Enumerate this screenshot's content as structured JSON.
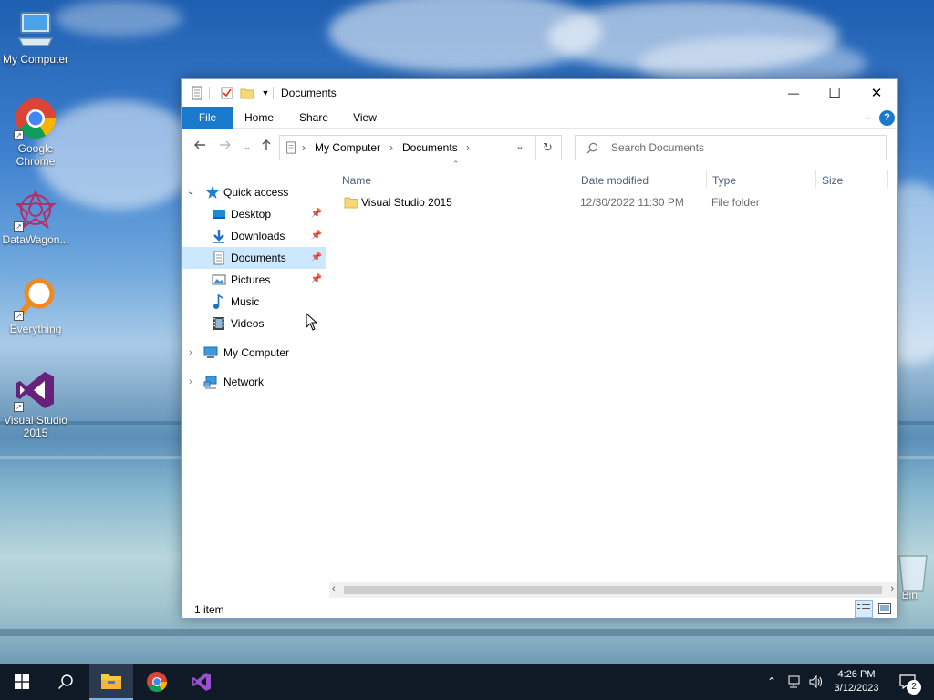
{
  "desktop": {
    "icons": [
      {
        "label": "My Computer",
        "icon": "computer-icon"
      },
      {
        "label": "Google Chrome",
        "icon": "chrome-icon"
      },
      {
        "label": "DataWagon...",
        "icon": "datawagon-icon"
      },
      {
        "label": "Everything",
        "icon": "everything-search-icon"
      },
      {
        "label": "Visual Studio 2015",
        "icon": "visual-studio-icon"
      },
      {
        "label": "Bin",
        "icon": "recycle-bin-icon"
      }
    ]
  },
  "window": {
    "title": "Documents",
    "controls": {
      "minimize": "—",
      "maximize": "☐",
      "close": "✕"
    },
    "ribbon": {
      "tabs": [
        "File",
        "Home",
        "Share",
        "View"
      ],
      "help": "?"
    },
    "address": {
      "breadcrumb": [
        "My Computer",
        "Documents"
      ],
      "separator": "›",
      "search_placeholder": "Search Documents"
    },
    "nav": {
      "quick_access": "Quick access",
      "items": [
        {
          "label": "Desktop",
          "pinned": true
        },
        {
          "label": "Downloads",
          "pinned": true
        },
        {
          "label": "Documents",
          "pinned": true,
          "selected": true
        },
        {
          "label": "Pictures",
          "pinned": true
        },
        {
          "label": "Music",
          "pinned": false
        },
        {
          "label": "Videos",
          "pinned": false
        }
      ],
      "my_computer": "My Computer",
      "network": "Network"
    },
    "columns": [
      "Name",
      "Date modified",
      "Type",
      "Size"
    ],
    "files": [
      {
        "name": "Visual Studio 2015",
        "date": "12/30/2022 11:30 PM",
        "type": "File folder",
        "size": ""
      }
    ],
    "status": "1 item"
  },
  "taskbar": {
    "time": "4:26 PM",
    "date": "3/12/2023",
    "notifications": "2"
  },
  "colors": {
    "accent": "#1979ca",
    "selection": "#cce8ff",
    "taskbar": "#101a26"
  }
}
